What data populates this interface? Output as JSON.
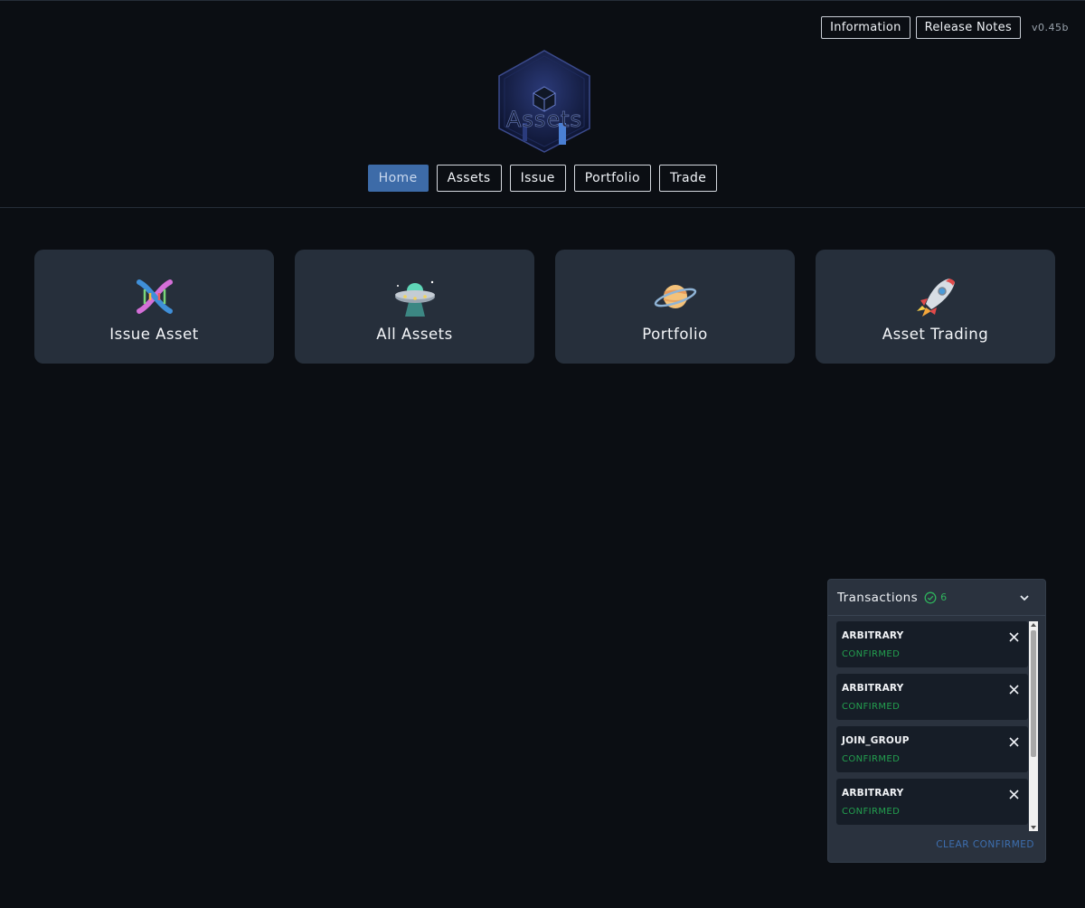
{
  "header": {
    "info_label": "Information",
    "release_notes_label": "Release Notes",
    "version": "v0.45b",
    "logo_text": "Assets"
  },
  "nav": {
    "items": [
      {
        "label": "Home",
        "active": true
      },
      {
        "label": "Assets",
        "active": false
      },
      {
        "label": "Issue",
        "active": false
      },
      {
        "label": "Portfolio",
        "active": false
      },
      {
        "label": "Trade",
        "active": false
      }
    ]
  },
  "cards": [
    {
      "title": "Issue Asset",
      "icon": "dna-icon"
    },
    {
      "title": "All Assets",
      "icon": "ufo-icon"
    },
    {
      "title": "Portfolio",
      "icon": "planet-icon"
    },
    {
      "title": "Asset Trading",
      "icon": "rocket-icon"
    }
  ],
  "transactions": {
    "title": "Transactions",
    "confirmed_count": "6",
    "items": [
      {
        "type": "ARBITRARY",
        "status": "CONFIRMED"
      },
      {
        "type": "ARBITRARY",
        "status": "CONFIRMED"
      },
      {
        "type": "JOIN_GROUP",
        "status": "CONFIRMED"
      },
      {
        "type": "ARBITRARY",
        "status": "CONFIRMED"
      }
    ],
    "clear_label": "CLEAR CONFIRMED"
  },
  "colors": {
    "background": "#0b0e13",
    "card": "#262f3b",
    "active_nav": "#3d6ba8",
    "confirmed": "#23a04f",
    "link": "#3d6fb0"
  }
}
